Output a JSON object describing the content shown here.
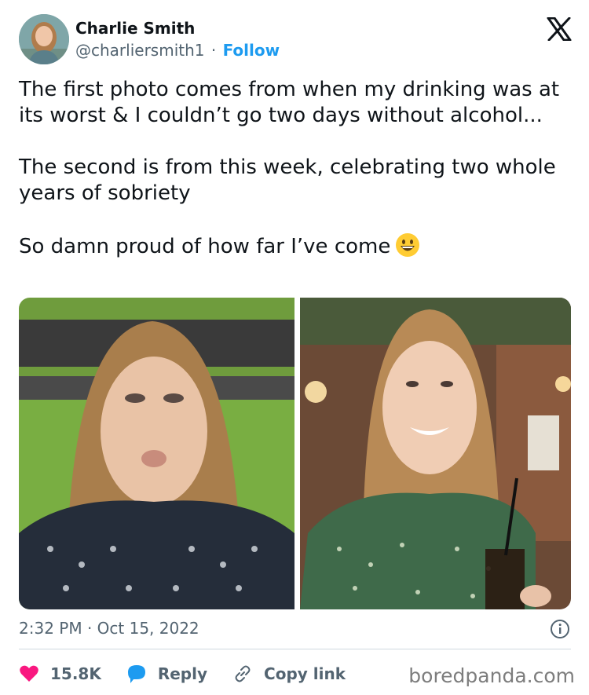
{
  "author": {
    "name": "Charlie Smith",
    "handle": "@charliersmith1",
    "separator": "·",
    "follow_label": "Follow"
  },
  "tweet": {
    "paragraphs": [
      "The first photo comes from when my drinking was at its worst & I couldn’t go two days without alcohol...",
      "The second is from this week, celebrating two whole years of sobriety",
      "So damn proud of how far I’ve come"
    ],
    "emoji": "grinning-face-emoji",
    "timestamp": "2:32 PM · Oct 15, 2022"
  },
  "media": [
    {
      "name": "before-photo",
      "description": "woman in patterned sweater, grimacing"
    },
    {
      "name": "after-photo",
      "description": "woman in floral dress smiling with drink"
    }
  ],
  "actions": {
    "likes": "15.8K",
    "reply_label": "Reply",
    "copy_link_label": "Copy link"
  },
  "watermark": "boredpanda.com",
  "icons": {
    "like": "heart-icon",
    "reply": "reply-bubble-icon",
    "copy_link": "link-icon",
    "info": "info-icon",
    "platform": "x-logo-icon"
  },
  "colors": {
    "accent": "#1d9bf0",
    "like": "#f91880",
    "secondary_text": "#536471",
    "divider": "#cfd9de"
  }
}
